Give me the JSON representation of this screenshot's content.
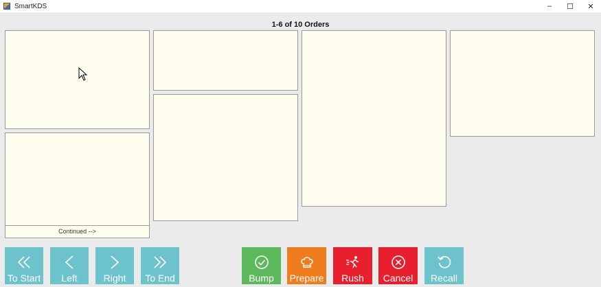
{
  "window": {
    "title": "SmartKDS",
    "minimize": "–",
    "maximize": "☐",
    "close": "✕"
  },
  "header": {
    "orders_range": "1-6 of 10 Orders"
  },
  "orders": {
    "continued_label": "Continued -->"
  },
  "nav_buttons": {
    "to_start": "To Start",
    "left": "Left",
    "right": "Right",
    "to_end": "To End"
  },
  "action_buttons": {
    "bump": "Bump",
    "prepare": "Prepare",
    "rush": "Rush",
    "cancel": "Cancel",
    "recall": "Recall"
  },
  "colors": {
    "nav": "#6cc3cb",
    "bump": "#5cb85c",
    "prepare": "#f07d1d",
    "rush": "#e8202e",
    "cancel": "#e8202e",
    "recall": "#6cc3cb",
    "order_bg": "#fffeee"
  }
}
